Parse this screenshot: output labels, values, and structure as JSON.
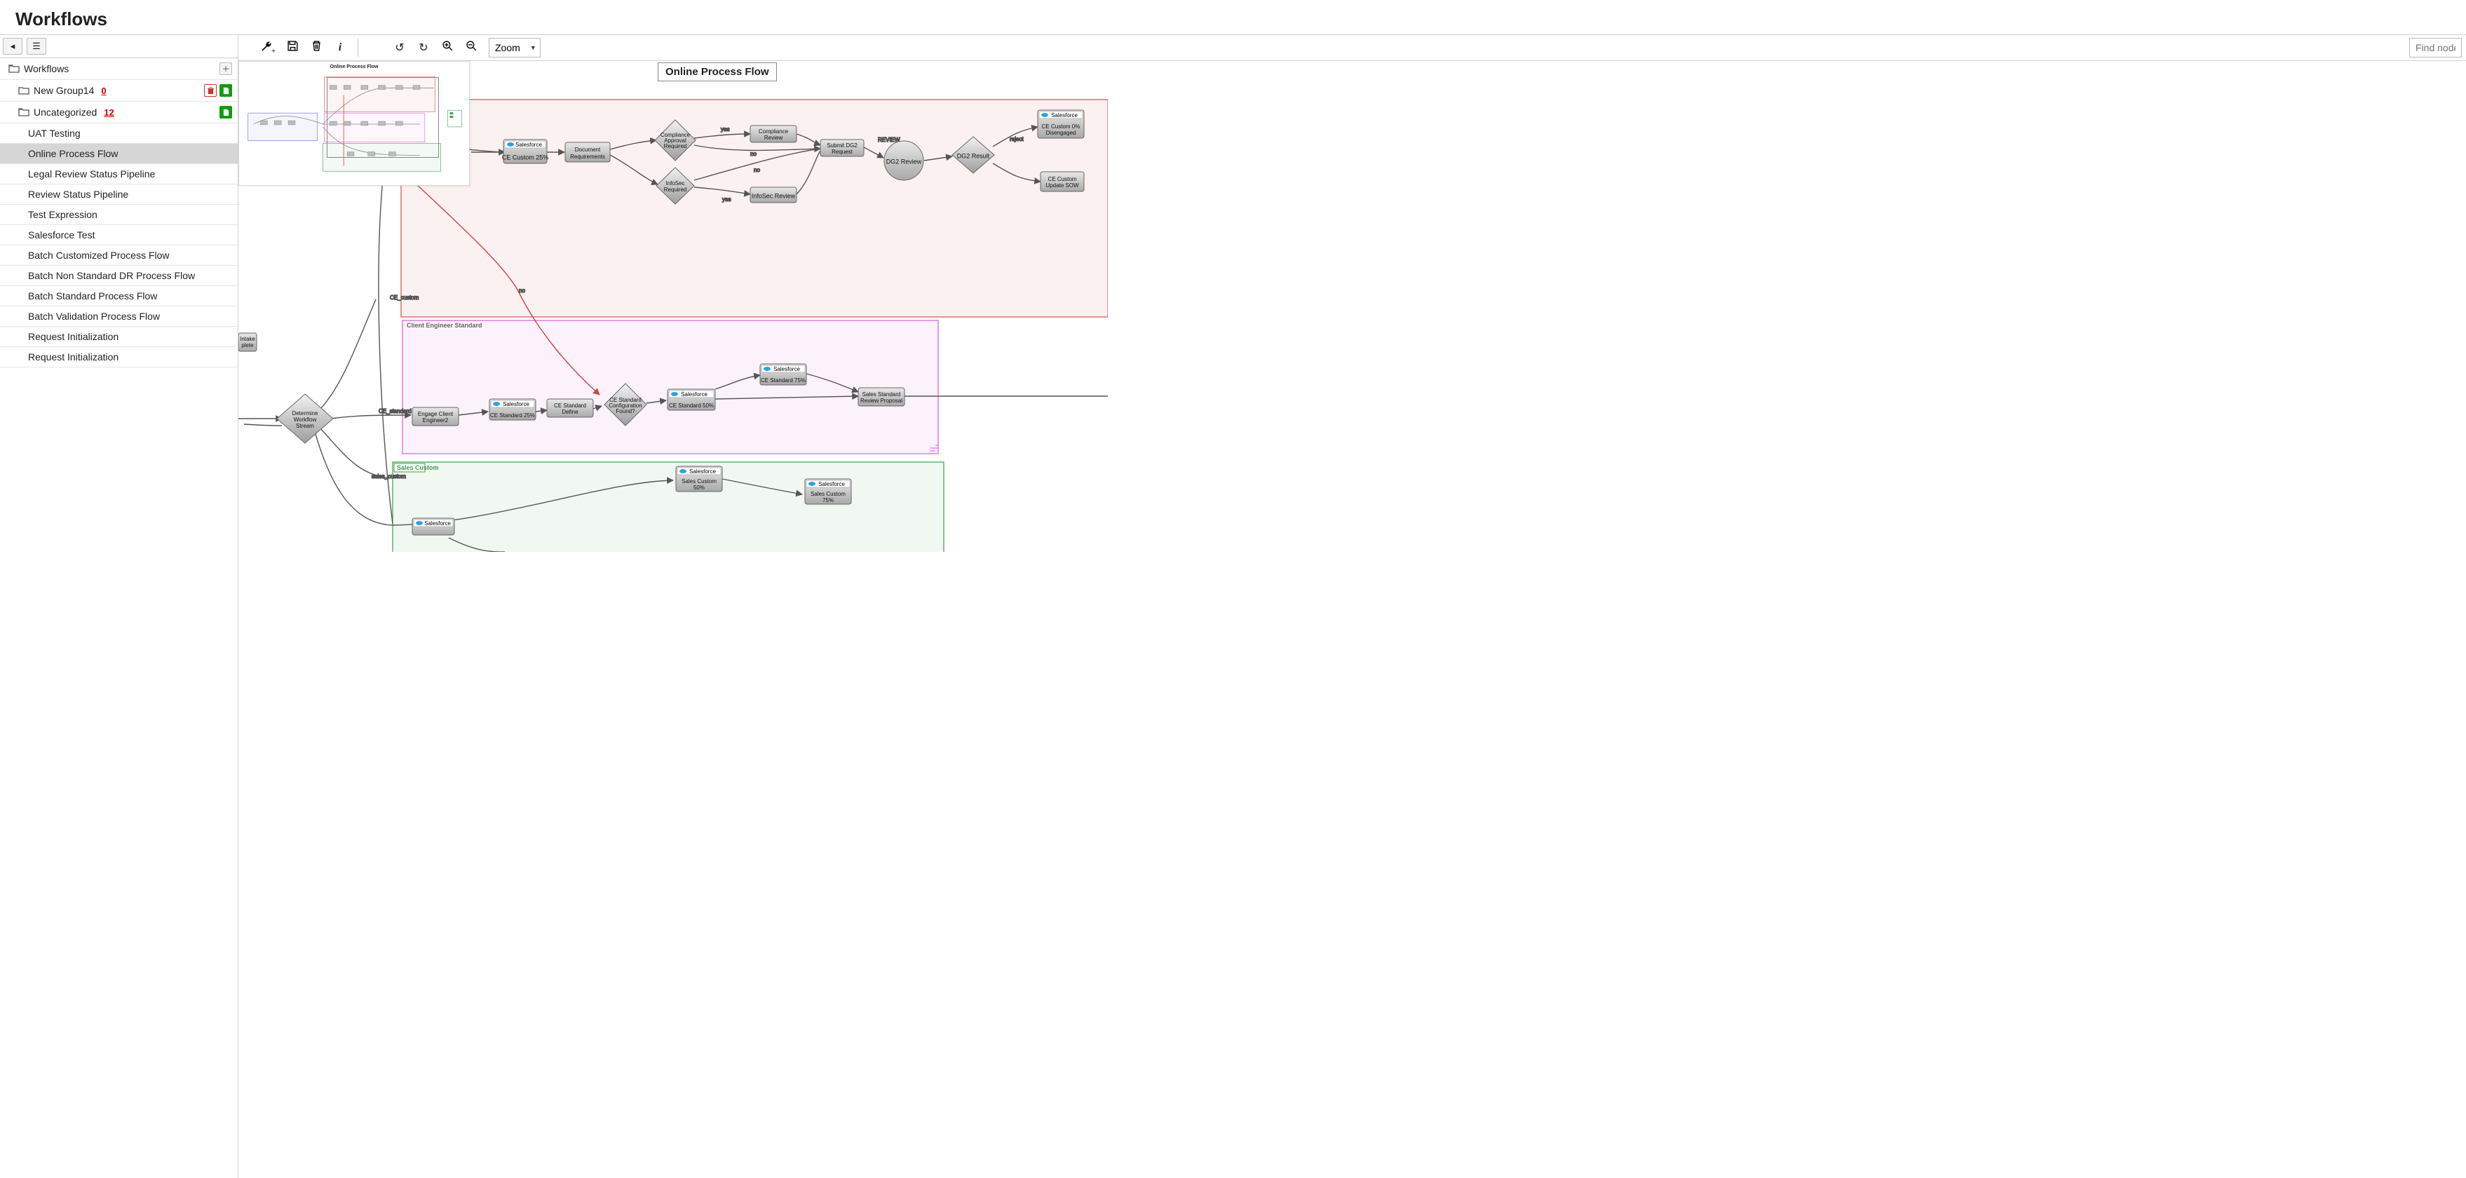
{
  "page_title": "Workflows",
  "sidebar": {
    "root_label": "Workflows",
    "groups": [
      {
        "label": "New Group14",
        "count": "0",
        "actions": [
          "delete",
          "add"
        ]
      },
      {
        "label": "Uncategorized",
        "count": "12",
        "actions": [
          "add"
        ]
      }
    ],
    "workflows": [
      "UAT Testing",
      "Online Process Flow",
      "Legal Review Status Pipeline",
      "Review Status Pipeline",
      "Test Expression",
      "Salesforce Test",
      "Batch Customized Process Flow",
      "Batch Non Standard DR Process Flow",
      "Batch Standard Process Flow",
      "Batch Validation Process Flow",
      "Request Initialization",
      "Request Initialization"
    ],
    "selected_workflow": "Online Process Flow"
  },
  "toolbar": {
    "zoom_placeholder": "Zoom",
    "find_placeholder": "Find node"
  },
  "canvas": {
    "title": "Online Process Flow",
    "minimap_title": "Online Process Flow",
    "regions": {
      "top": {
        "label": "",
        "fill": "#d94c4c",
        "stroke": "#d94c4c"
      },
      "middle": {
        "label": "Client Engineer Standard",
        "fill": "#d95ed9",
        "stroke": "#d95ed9"
      },
      "bottom": {
        "label": "Sales Custom",
        "fill": "#3aa04a",
        "stroke": "#3aa04a"
      }
    },
    "edge_labels": {
      "top_yes1": "yes",
      "top_no1": "no",
      "top_yes2": "yes",
      "top_no2": "no",
      "top_no3": "no",
      "review": "REVIEW",
      "reject": "reject",
      "ce_custom": "CE_custom",
      "ce_standard": "CE_standard",
      "sales_custom": "sales_custom"
    },
    "nodes": {
      "intake_complete": {
        "line1": "Intake",
        "line2": "plete"
      },
      "determine_stream": {
        "line1": "Determine",
        "line2": "Workflow",
        "line3": "Stream"
      },
      "ce_custom_25": {
        "sf": "Salesforce",
        "label": "CE Custom 25%"
      },
      "doc_req": {
        "line1": "Document",
        "line2": "Requirements"
      },
      "compliance_approval": {
        "line1": "Compliance",
        "line2": "Approval",
        "line3": "Required"
      },
      "infosec_required": {
        "line1": "InfoSec",
        "line2": "Required"
      },
      "compliance_review": {
        "line1": "Compliance",
        "line2": "Review"
      },
      "infosec_review": {
        "label": "InfoSec Review"
      },
      "submit_dg2": {
        "line1": "Submit DG2",
        "line2": "Request"
      },
      "dg2_review": {
        "label": "DG2 Review"
      },
      "dg2_result": {
        "label": "DG2 Result"
      },
      "ce_custom_0_diseng": {
        "sf": "Salesforce",
        "line1": "CE Custom 0%",
        "line2": "Disengaged"
      },
      "ce_custom_update_sow": {
        "line1": "CE Custom",
        "line2": "Update SOW"
      },
      "engage_ce2": {
        "line1": "Engage Client",
        "line2": "Engineer2"
      },
      "ce_std_25": {
        "sf": "Salesforce",
        "label": "CE Standard 25%"
      },
      "ce_std_define": {
        "line1": "CE Standard",
        "line2": "Define"
      },
      "ce_std_config_found": {
        "line1": "CE Standard",
        "line2": "Configuration",
        "line3": "Found?"
      },
      "ce_std_50": {
        "sf": "Salesforce",
        "label": "CE Standard 50%"
      },
      "ce_std_75": {
        "sf": "Salesforce",
        "label": "CE Standard 75%"
      },
      "sales_std_review": {
        "line1": "Sales Standard",
        "line2": "Review Proposal"
      },
      "sales_custom_50": {
        "sf": "Salesforce",
        "line1": "Sales Custom",
        "line2": "50%"
      },
      "sales_custom_75": {
        "sf": "Salesforce",
        "line1": "Sales Custom",
        "line2": "75%"
      },
      "sf_bottom": {
        "sf": "Salesforce"
      }
    }
  }
}
